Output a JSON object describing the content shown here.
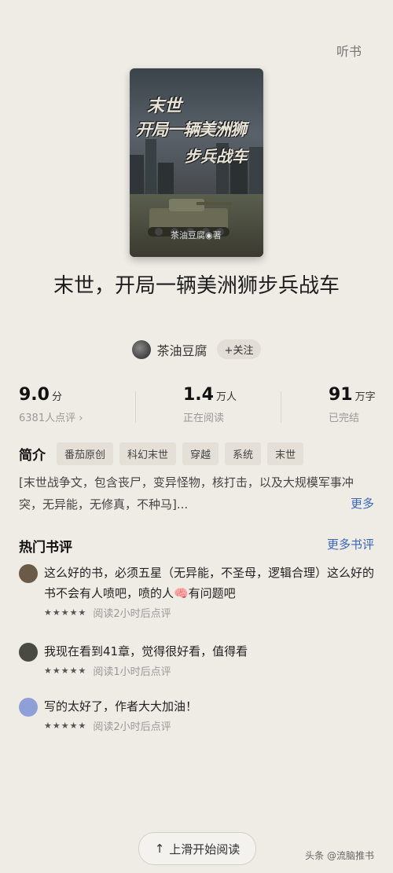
{
  "header": {
    "listen_label": "听书"
  },
  "cover": {
    "title_line1": "末世",
    "title_line2": "开局一辆美洲狮",
    "title_line3": "步兵战车",
    "author_mark": "茶油豆腐◉著"
  },
  "book": {
    "title": "末世，开局一辆美洲狮步兵战车"
  },
  "author": {
    "name": "茶油豆腐",
    "follow_label": "+关注"
  },
  "stats": {
    "rating": {
      "value": "9.0",
      "unit": "分",
      "sub": "6381人点评 ›"
    },
    "readers": {
      "value": "1.4",
      "unit": "万人",
      "sub": "正在阅读"
    },
    "words": {
      "value": "91",
      "unit": "万字",
      "sub": "已完结"
    }
  },
  "intro": {
    "heading": "简介",
    "tags": [
      "番茄原创",
      "科幻末世",
      "穿越",
      "系统",
      "末世"
    ],
    "text": "[末世战争文，包含丧尸，变异怪物，核打击，以及大规模军事冲突，无异能，无修真，不种马]...",
    "more_label": "更多"
  },
  "reviews": {
    "heading": "热门书评",
    "more_label": "更多书评",
    "items": [
      {
        "text": "这么好的书，必须五星（无异能，不圣母，逻辑合理）这么好的书不会有人喷吧，喷的人🧠有问题吧",
        "stars": "★★★★★",
        "meta": "阅读2小时后点评",
        "avatar_color": "#6b5a48"
      },
      {
        "text": "我现在看到41章，觉得很好看，值得看",
        "stars": "★★★★★",
        "meta": "阅读1小时后点评",
        "avatar_color": "#4a4a44"
      },
      {
        "text": "写的太好了，作者大大加油！",
        "stars": "★★★★★",
        "meta": "阅读2小时后点评",
        "avatar_color": "#8fa0d8"
      }
    ]
  },
  "footer": {
    "read_label": "上滑开始阅读",
    "arrow": "↑",
    "watermark": "头条 @流脑推书"
  }
}
